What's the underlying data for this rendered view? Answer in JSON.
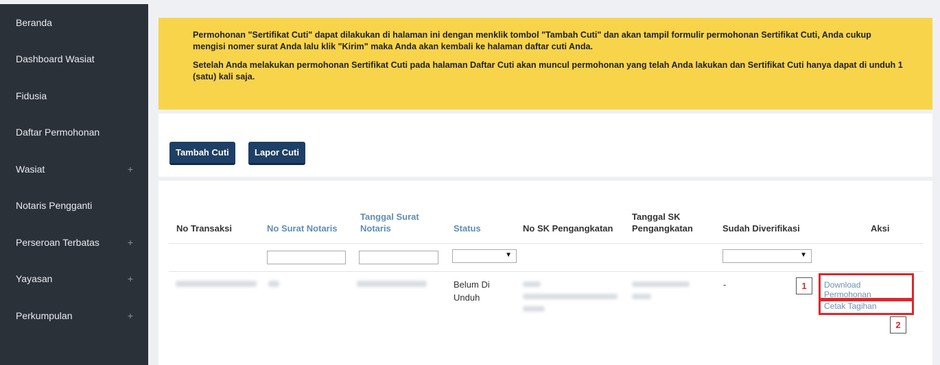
{
  "sidebar": {
    "items": [
      {
        "label": "Beranda",
        "plus": ""
      },
      {
        "label": "Dashboard Wasiat",
        "plus": ""
      },
      {
        "label": "Fidusia",
        "plus": ""
      },
      {
        "label": "Daftar Permohonan",
        "plus": ""
      },
      {
        "label": "Wasiat",
        "plus": "+"
      },
      {
        "label": "Notaris Pengganti",
        "plus": ""
      },
      {
        "label": "Perseroan Terbatas",
        "plus": "+"
      },
      {
        "label": "Yayasan",
        "plus": "+"
      },
      {
        "label": "Perkumpulan",
        "plus": "+"
      }
    ]
  },
  "notice": {
    "paragraph1": "Permohonan \"Sertifikat Cuti\" dapat dilakukan di halaman ini dengan menklik tombol \"Tambah Cuti\" dan akan tampil formulir permohonan Sertifikat Cuti, Anda cukup mengisi nomer surat Anda lalu klik \"Kirim\" maka Anda akan kembali ke halaman daftar cuti Anda.",
    "paragraph2": "Setelah Anda melakukan permohonan Sertifikat Cuti pada halaman Daftar Cuti akan muncul permohonan yang telah Anda lakukan dan Sertifikat Cuti hanya dapat di unduh 1 (satu) kali saja."
  },
  "buttons": {
    "tambah": "Tambah Cuti",
    "lapor": "Lapor Cuti"
  },
  "table": {
    "headers": {
      "no_transaksi": "No Transaksi",
      "no_surat": "No Surat Notaris",
      "tanggal_surat": "Tanggal Surat Notaris",
      "status": "Status",
      "no_sk": "No SK Pengangkatan",
      "tanggal_sk": "Tanggal SK Pengangkatan",
      "sudah_diverifikasi": "Sudah Diverifikasi",
      "aksi": "Aksi"
    },
    "filters": {
      "status_arrow": "▼",
      "diverifikasi_arrow": "▼"
    },
    "row": {
      "status": "Belum Di Unduh",
      "diverifikasi": "-",
      "action_download": "Download Permohonan",
      "action_cetak": "Cetak Tagihan"
    }
  },
  "annotations": {
    "marker1": "1",
    "marker2": "2"
  },
  "colors": {
    "sidebar_bg": "#2b3139",
    "notice_bg": "#f8d44b",
    "button_bg": "#1e3f66",
    "highlight_red": "#e0262b",
    "link_blue": "#6b90b3"
  }
}
